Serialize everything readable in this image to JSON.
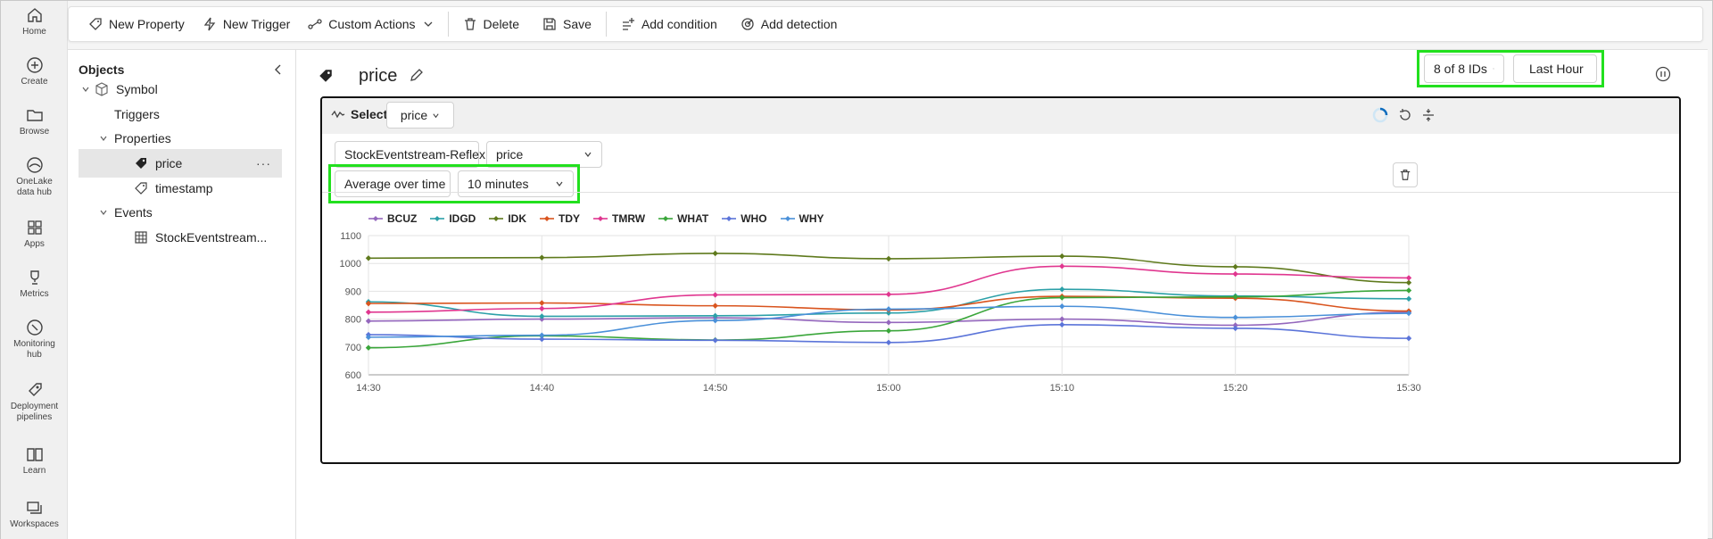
{
  "rail": [
    {
      "name": "home",
      "label": "Home",
      "icon": "home-icon"
    },
    {
      "name": "create",
      "label": "Create",
      "icon": "plus-circle-icon"
    },
    {
      "name": "browse",
      "label": "Browse",
      "icon": "folder-icon"
    },
    {
      "name": "onelake",
      "label": "OneLake data hub",
      "icon": "onelake-icon"
    },
    {
      "name": "apps",
      "label": "Apps",
      "icon": "apps-icon"
    },
    {
      "name": "metrics",
      "label": "Metrics",
      "icon": "trophy-icon"
    },
    {
      "name": "monitoring",
      "label": "Monitoring hub",
      "icon": "monitor-icon"
    },
    {
      "name": "deployment",
      "label": "Deployment pipelines",
      "icon": "rocket-icon"
    },
    {
      "name": "learn",
      "label": "Learn",
      "icon": "book-icon"
    },
    {
      "name": "workspaces",
      "label": "Workspaces",
      "icon": "workspaces-icon"
    }
  ],
  "toolbar": {
    "new_property": "New Property",
    "new_trigger": "New Trigger",
    "custom_actions": "Custom Actions",
    "delete": "Delete",
    "save": "Save",
    "add_condition": "Add condition",
    "add_detection": "Add detection"
  },
  "objects": {
    "title": "Objects",
    "symbol": "Symbol",
    "triggers": "Triggers",
    "properties": "Properties",
    "price": "price",
    "timestamp": "timestamp",
    "events": "Events",
    "stream": "StockEventstream..."
  },
  "header": {
    "title": "price",
    "ids": "8 of 8 IDs",
    "range": "Last Hour"
  },
  "card": {
    "select_label": "Select",
    "select_value": "price",
    "source": "StockEventstream-Reflex",
    "property": "price",
    "aggregation": "Average over time",
    "window": "10 minutes"
  },
  "chart_data": {
    "type": "line",
    "x": [
      "14:30",
      "14:40",
      "14:50",
      "15:00",
      "15:10",
      "15:20",
      "15:30"
    ],
    "ylim": [
      600,
      1100
    ],
    "yticks": [
      600,
      700,
      800,
      900,
      1000,
      1100
    ],
    "grid": true,
    "legend_position": "top-left",
    "series": [
      {
        "name": "BCUZ",
        "color": "#9467bd",
        "values": [
          793,
          800,
          805,
          788,
          800,
          778,
          825
        ]
      },
      {
        "name": "IDGD",
        "color": "#2ca0a8",
        "values": [
          862,
          810,
          812,
          822,
          907,
          883,
          873
        ]
      },
      {
        "name": "IDK",
        "color": "#5f7a1d",
        "values": [
          1019,
          1021,
          1036,
          1017,
          1026,
          988,
          931
        ]
      },
      {
        "name": "TDY",
        "color": "#d9541e",
        "values": [
          856,
          858,
          848,
          833,
          882,
          875,
          829
        ]
      },
      {
        "name": "TMRW",
        "color": "#e0368f",
        "values": [
          825,
          838,
          887,
          889,
          990,
          962,
          948
        ]
      },
      {
        "name": "WHAT",
        "color": "#3aa63a",
        "values": [
          697,
          740,
          725,
          758,
          877,
          880,
          903
        ]
      },
      {
        "name": "WHO",
        "color": "#5b74d9",
        "values": [
          744,
          728,
          724,
          716,
          780,
          767,
          731
        ]
      },
      {
        "name": "WHY",
        "color": "#4a90d9",
        "values": [
          735,
          742,
          795,
          836,
          846,
          806,
          821
        ]
      }
    ]
  }
}
